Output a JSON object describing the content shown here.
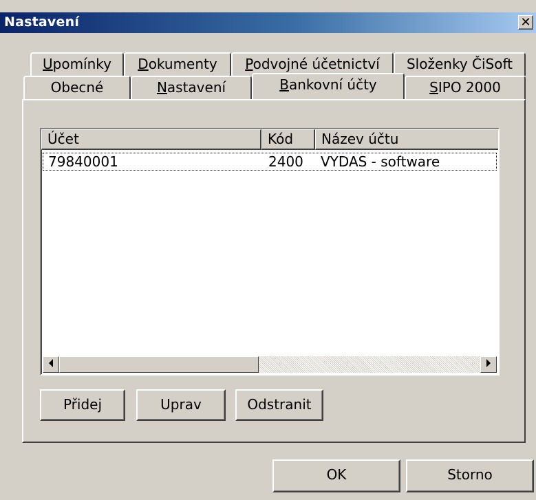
{
  "window": {
    "title": "Nastavení",
    "close_glyph": "✕"
  },
  "tabs": {
    "row1": [
      {
        "prefix": "",
        "hot": "U",
        "rest": "pomínky"
      },
      {
        "prefix": "",
        "hot": "D",
        "rest": "okumenty"
      },
      {
        "prefix": "",
        "hot": "P",
        "rest": "odvojné účetnictví"
      },
      {
        "prefix": "Složenky ČiSoft",
        "hot": "",
        "rest": ""
      }
    ],
    "row2": [
      {
        "prefix": "Obecné",
        "hot": "",
        "rest": ""
      },
      {
        "prefix": "",
        "hot": "N",
        "rest": "astavení"
      },
      {
        "prefix": "",
        "hot": "B",
        "rest": "ankovní účty"
      },
      {
        "prefix": "",
        "hot": "S",
        "rest": "IPO 2000"
      }
    ],
    "selected": "Bankovní účty"
  },
  "list": {
    "columns": [
      "Účet",
      "Kód",
      "Název účtu"
    ],
    "rows": [
      {
        "ucet": "79840001",
        "kod": "2400",
        "nazev": "VYDAS - software"
      }
    ],
    "scroll_left_icon": "scroll-left-arrow",
    "scroll_right_icon": "scroll-right-arrow"
  },
  "buttons": {
    "add": "Přidej",
    "edit": "Uprav",
    "remove": "Odstranit",
    "ok": "OK",
    "cancel": "Storno"
  }
}
